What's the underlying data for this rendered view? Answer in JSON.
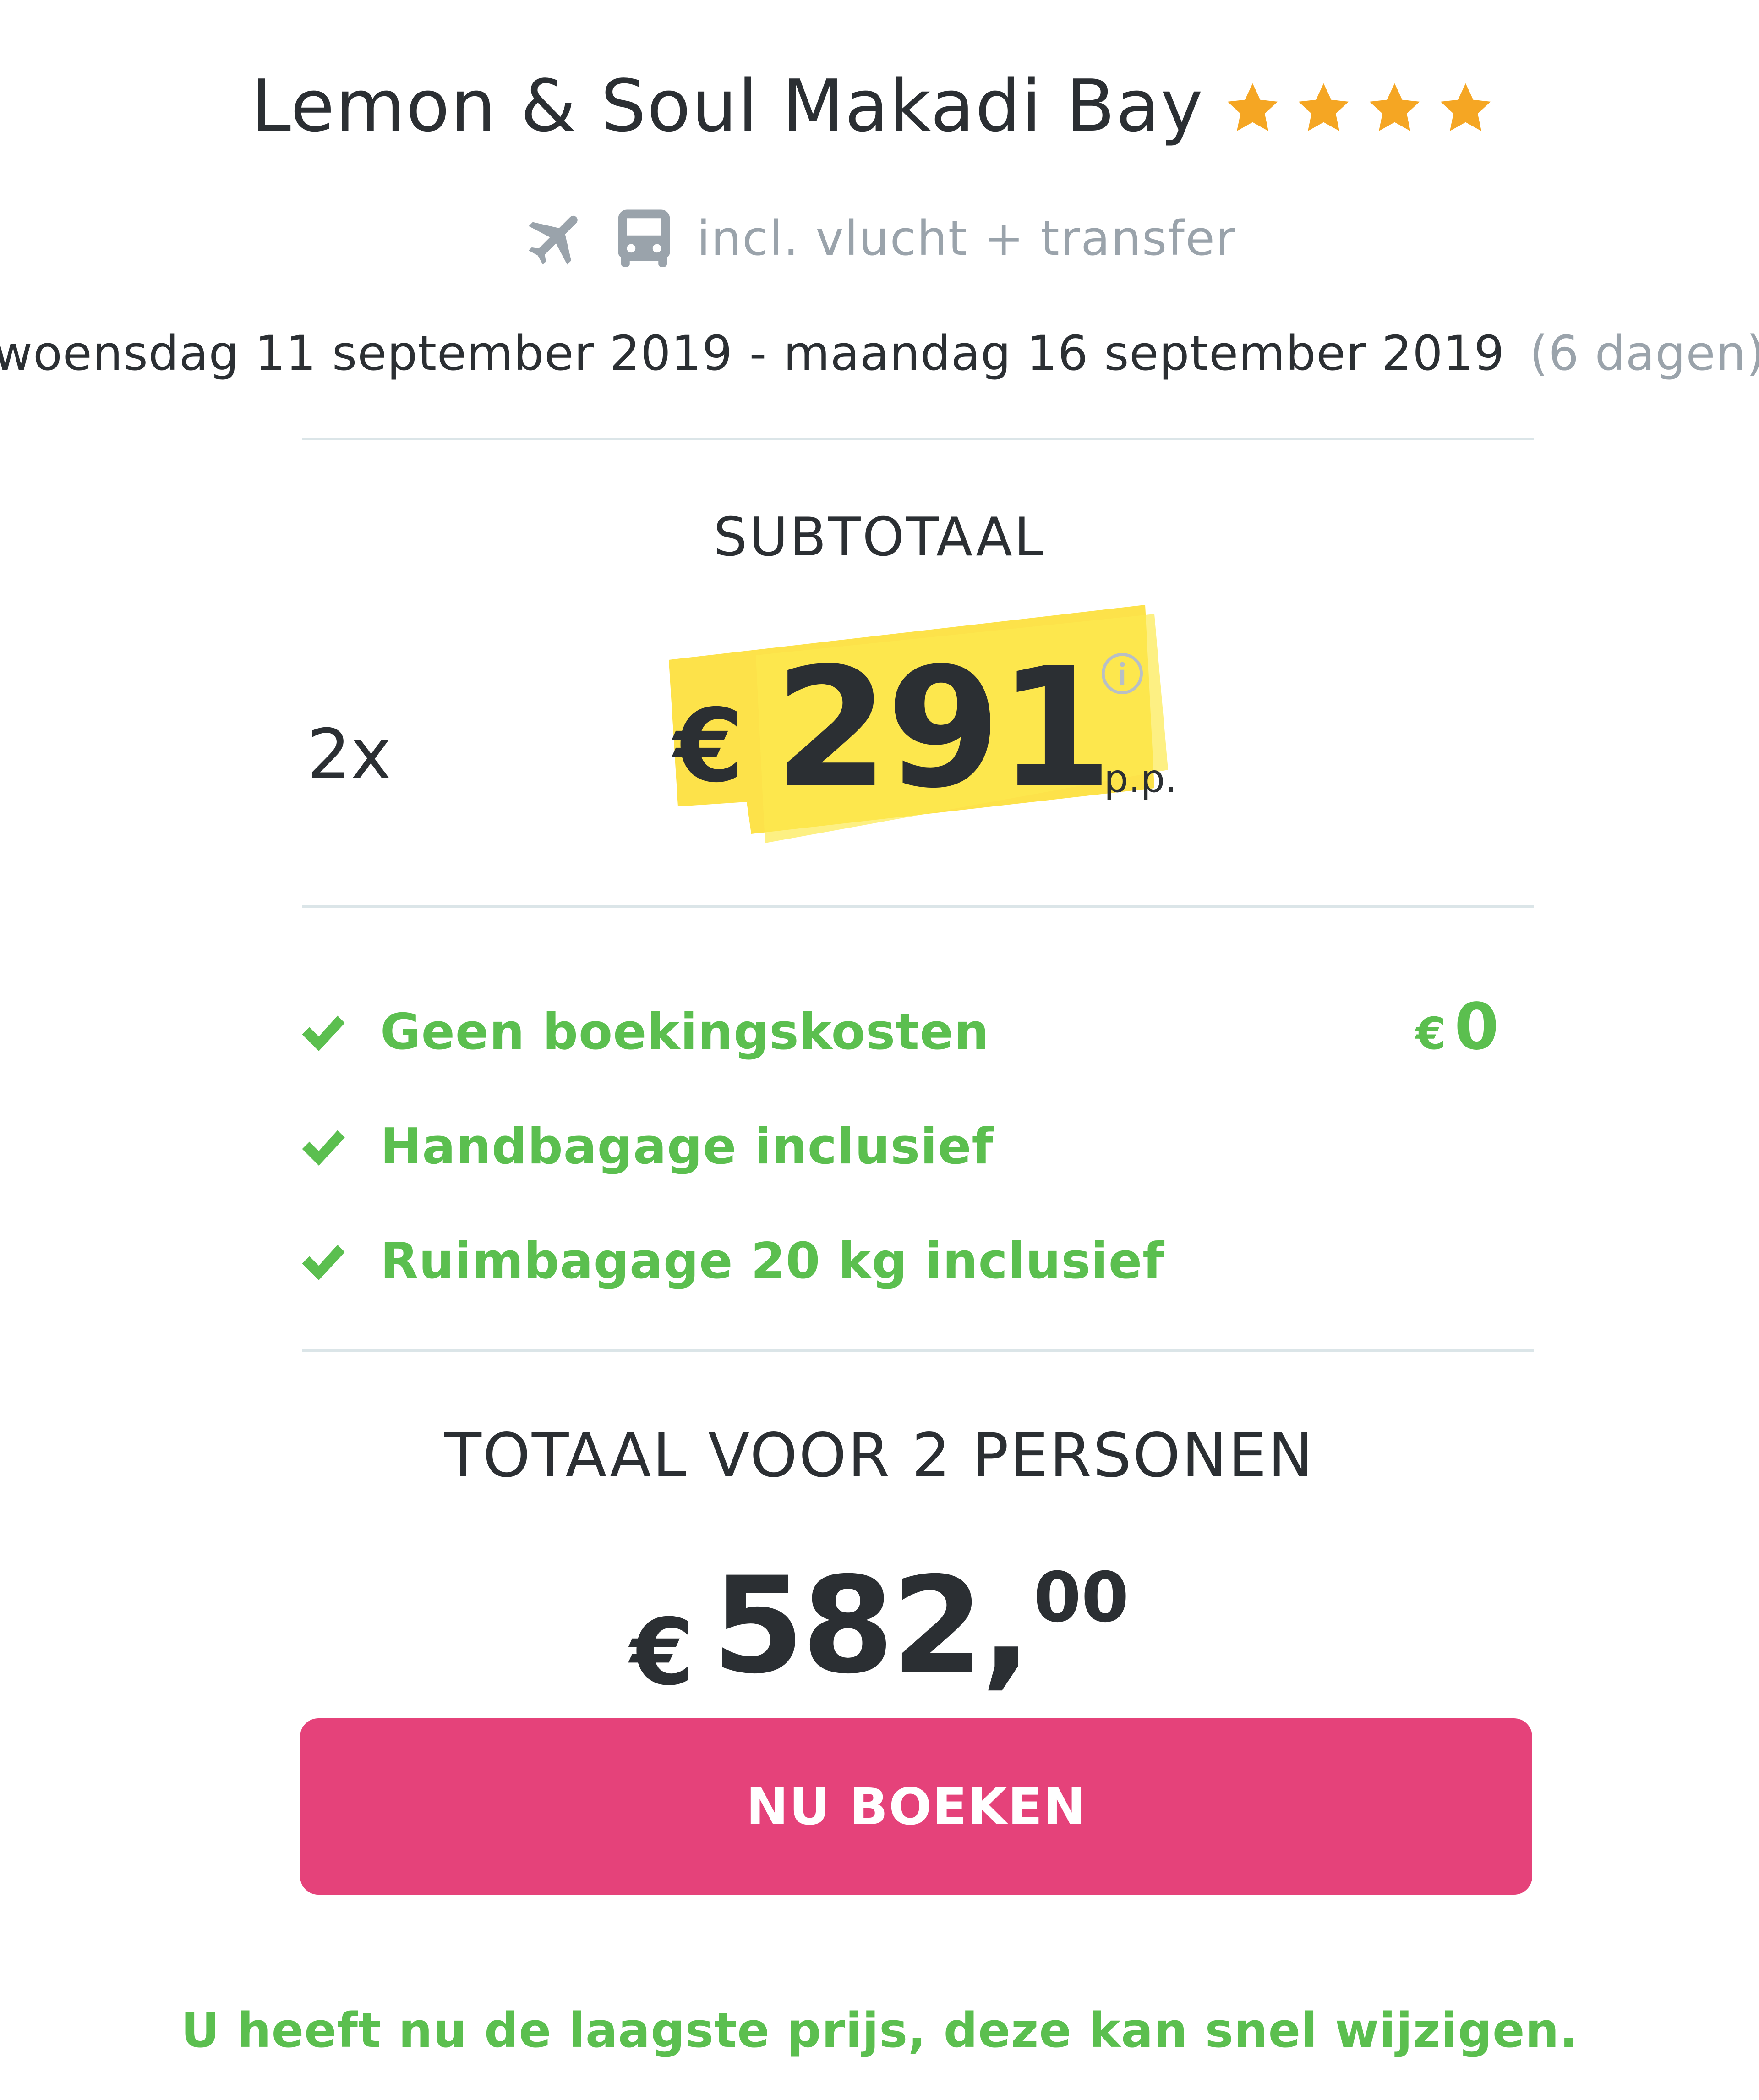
{
  "hotel": {
    "name": "Lemon & Soul Makadi Bay",
    "stars": 4,
    "star_color": "#f5a623"
  },
  "inclusions": {
    "icons": [
      "plane-icon",
      "bus-icon"
    ],
    "text": "incl. vlucht + transfer"
  },
  "dates": {
    "start": "woensdag 11 september 2019",
    "separator": "-",
    "end": "maandag 16 september 2019",
    "duration": "(6 dagen)"
  },
  "subtotal": {
    "label": "SUBTOTAAL",
    "multiplier": "2x",
    "currency": "€",
    "amount": "291",
    "unit": "p.p.",
    "highlight_color": "#fde24a"
  },
  "features": [
    {
      "text": "Geen boekingskosten",
      "value_currency": "€",
      "value": "0"
    },
    {
      "text": "Handbagage inclusief"
    },
    {
      "text": "Ruimbagage 20 kg inclusief"
    }
  ],
  "total": {
    "label": "TOTAAL VOOR 2 PERSONEN",
    "currency": "€",
    "amount": "582,",
    "cents": "00"
  },
  "book_button": {
    "label": "NU BOEKEN",
    "color": "#e5427a"
  },
  "note": "U heeft nu de laagste prijs, deze kan snel wijzigen.",
  "colors": {
    "green": "#5bbf4f",
    "text": "#2b2f33",
    "muted": "#9aa3ab"
  }
}
